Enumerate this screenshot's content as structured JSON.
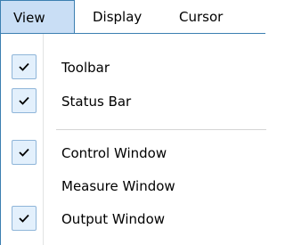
{
  "menubar": {
    "items": [
      {
        "label": "View"
      },
      {
        "label": "Display"
      },
      {
        "label": "Cursor"
      }
    ]
  },
  "view_menu": {
    "items": [
      {
        "label": "Toolbar",
        "checked": true
      },
      {
        "label": "Status Bar",
        "checked": true
      },
      {
        "label": "Control Window",
        "checked": true
      },
      {
        "label": "Measure Window",
        "checked": false
      },
      {
        "label": "Output Window",
        "checked": true
      }
    ]
  },
  "colors": {
    "highlight": "#c9def5",
    "border": "#3c7fb1",
    "check_bg": "#e3f0fc"
  }
}
